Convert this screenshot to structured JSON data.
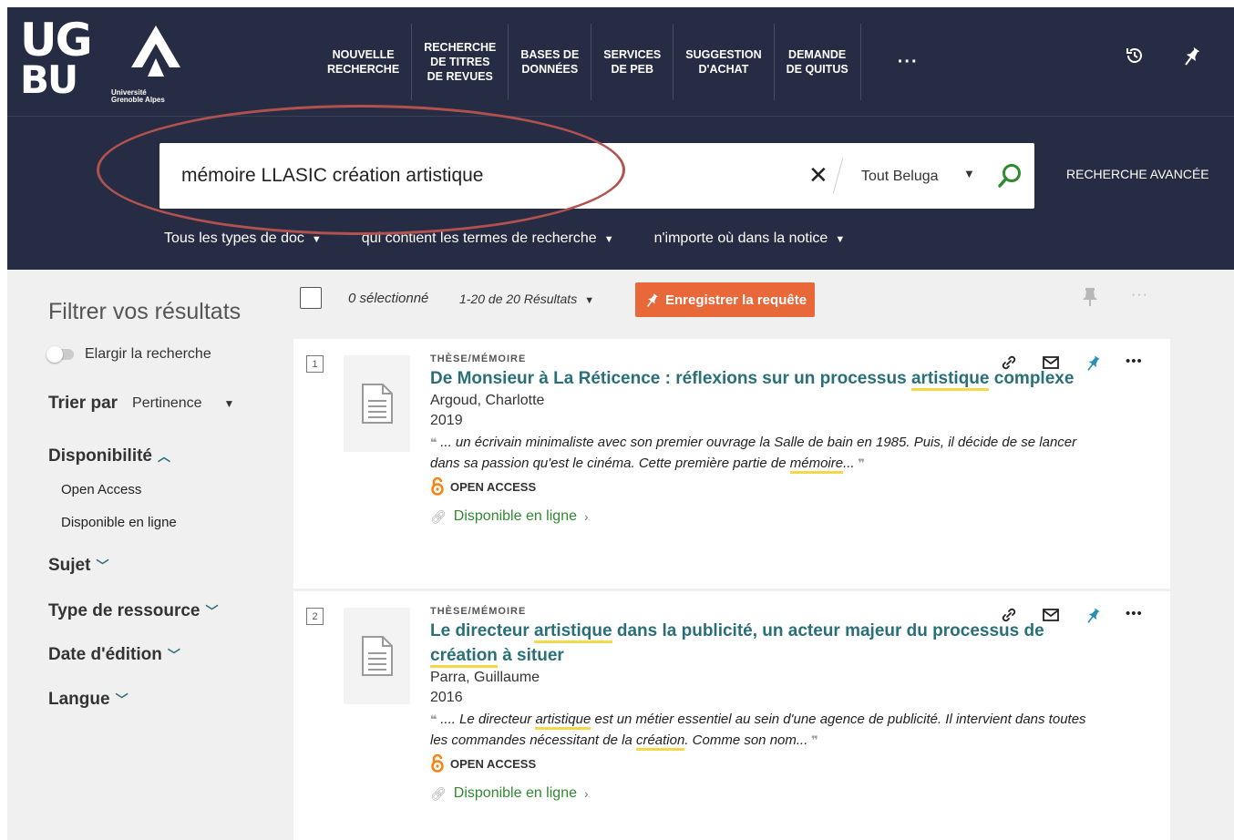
{
  "logo": {
    "line1": "UG",
    "line2": "BU",
    "subtitle_1": "Université",
    "subtitle_2": "Grenoble Alpes"
  },
  "nav": {
    "items": [
      {
        "label": "NOUVELLE\nRECHERCHE"
      },
      {
        "label": "RECHERCHE\nDE TITRES\nDE REVUES"
      },
      {
        "label": "BASES DE\nDONNÉES"
      },
      {
        "label": "SERVICES\nDE PEB"
      },
      {
        "label": "SUGGESTION\nD'ACHAT"
      },
      {
        "label": "DEMANDE\nDE QUITUS"
      }
    ],
    "more_label": "···"
  },
  "search": {
    "query": "mémoire LLASIC création artistique",
    "scope": "Tout Beluga",
    "advanced_label": "RECHERCHE AVANCÉE",
    "doc_type": "Tous les types de doc",
    "match_mode": "qui contient les termes de recherche",
    "field": "n'importe où dans la notice"
  },
  "sidebar": {
    "title": "Filtrer vos résultats",
    "expand_label": "Elargir la recherche",
    "sort_label": "Trier par",
    "sort_value": "Pertinence",
    "availability": {
      "label": "Disponibilité",
      "options": [
        "Open Access",
        "Disponible en ligne"
      ]
    },
    "facets": [
      "Sujet",
      "Type de ressource",
      "Date d'édition",
      "Langue"
    ]
  },
  "results_header": {
    "selected": "0 sélectionné",
    "count": "1-20 de 20 Résultats",
    "save_label": "Enregistrer la requête"
  },
  "results": [
    {
      "number": "1",
      "type": "THÈSE/MÉMOIRE",
      "title_parts": [
        "De Monsieur à La Réticence : réflexions sur un processus ",
        "artistique",
        " complexe"
      ],
      "author": "Argoud, Charlotte",
      "year": "2019",
      "snippet_parts": [
        "... un écrivain minimaliste avec son premier ouvrage la Salle de bain en 1985. Puis, il décide de se lancer dans sa passion qu'est le cinéma. Cette première partie de ",
        "mémoire",
        "..."
      ],
      "open_access": "OPEN ACCESS",
      "availability": "Disponible en ligne"
    },
    {
      "number": "2",
      "type": "THÈSE/MÉMOIRE",
      "title_parts": [
        "Le directeur ",
        "artistique",
        " dans la publicité, un acteur majeur du processus de ",
        "création",
        " à situer"
      ],
      "author": "Parra, Guillaume",
      "year": "2016",
      "snippet_parts": [
        ".... Le directeur ",
        "artistique",
        " est un métier essentiel au sein d'une agence de publicité. Il intervient dans toutes les commandes nécessitant de la ",
        "création",
        ". Comme son nom..."
      ],
      "open_access": "OPEN ACCESS",
      "availability": "Disponible en ligne"
    }
  ],
  "colors": {
    "header_bg": "#262c43",
    "accent_teal": "#2a6f78",
    "save_button": "#e8683a",
    "available_green": "#2f8a2f",
    "highlight": "#f5d74a",
    "annotation_ellipse": "#b2524f"
  },
  "icons": [
    "search-icon",
    "clear-icon",
    "history-icon",
    "pin-icon",
    "link-icon",
    "email-icon",
    "more-icon",
    "document-icon",
    "open-access-icon"
  ]
}
